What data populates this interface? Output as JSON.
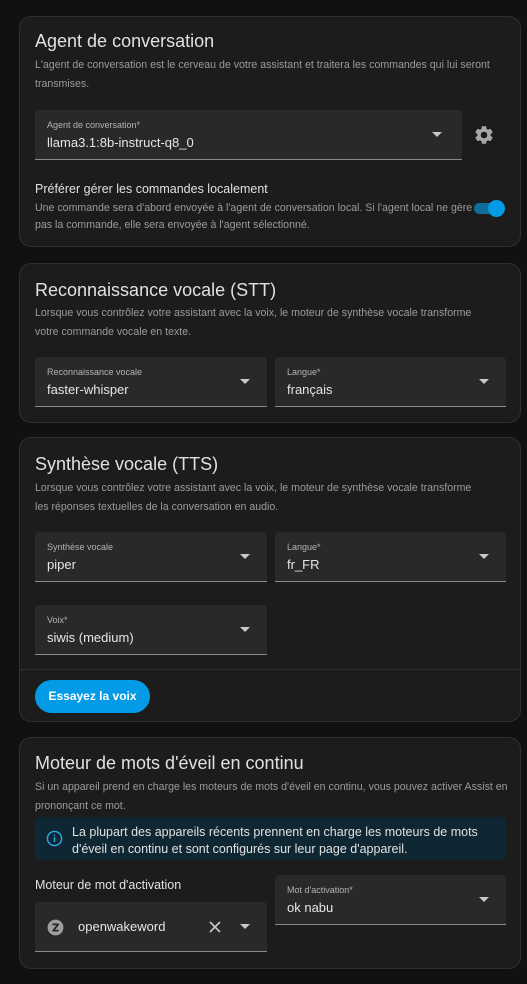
{
  "conversation": {
    "title": "Agent de conversation",
    "description": "L'agent de conversation est le cerveau de votre assistant et traitera les commandes qui lui seront transmises.",
    "agent_field": {
      "label": "Agent de conversation*",
      "value": "llama3.1:8b-instruct-q8_0"
    },
    "settings_icon": "gear-icon",
    "prefer_local": {
      "title": "Préférer gérer les commandes localement",
      "description": "Une commande sera d'abord envoyée à l'agent de conversation local. Si l'agent local ne gère pas la commande, elle sera envoyée à l'agent sélectionné.",
      "enabled": true
    }
  },
  "stt": {
    "title": "Reconnaissance vocale (STT)",
    "description": "Lorsque vous contrôlez votre assistant avec la voix, le moteur de synthèse vocale transforme votre commande vocale en texte.",
    "engine_field": {
      "label": "Reconnaissance vocale",
      "value": "faster-whisper"
    },
    "language_field": {
      "label": "Langue*",
      "value": "français"
    }
  },
  "tts": {
    "title": "Synthèse vocale (TTS)",
    "description": "Lorsque vous contrôlez votre assistant avec la voix, le moteur de synthèse vocale transforme les réponses textuelles de la conversation en audio.",
    "engine_field": {
      "label": "Synthèse vocale",
      "value": "piper"
    },
    "language_field": {
      "label": "Langue*",
      "value": "fr_FR"
    },
    "voice_field": {
      "label": "Voix*",
      "value": "siwis (medium)"
    },
    "try_button": "Essayez la voix"
  },
  "wakeword": {
    "title": "Moteur de mots d'éveil en continu",
    "description": "Si un appareil prend en charge les moteurs de mots d'éveil en continu, vous pouvez activer Assist en prononçant ce mot.",
    "info": "La plupart des appareils récents prennent en charge les moteurs de mots d'éveil en continu et sont configurés sur leur page d'appareil.",
    "engine_label": "Moteur de mot d'activation",
    "engine_value": "openwakeword",
    "word_field": {
      "label": "Mot d'activation*",
      "value": "ok nabu"
    }
  },
  "colors": {
    "accent": "#039be5",
    "background": "#111111",
    "card": "#1c1c1c",
    "field": "#292929"
  }
}
